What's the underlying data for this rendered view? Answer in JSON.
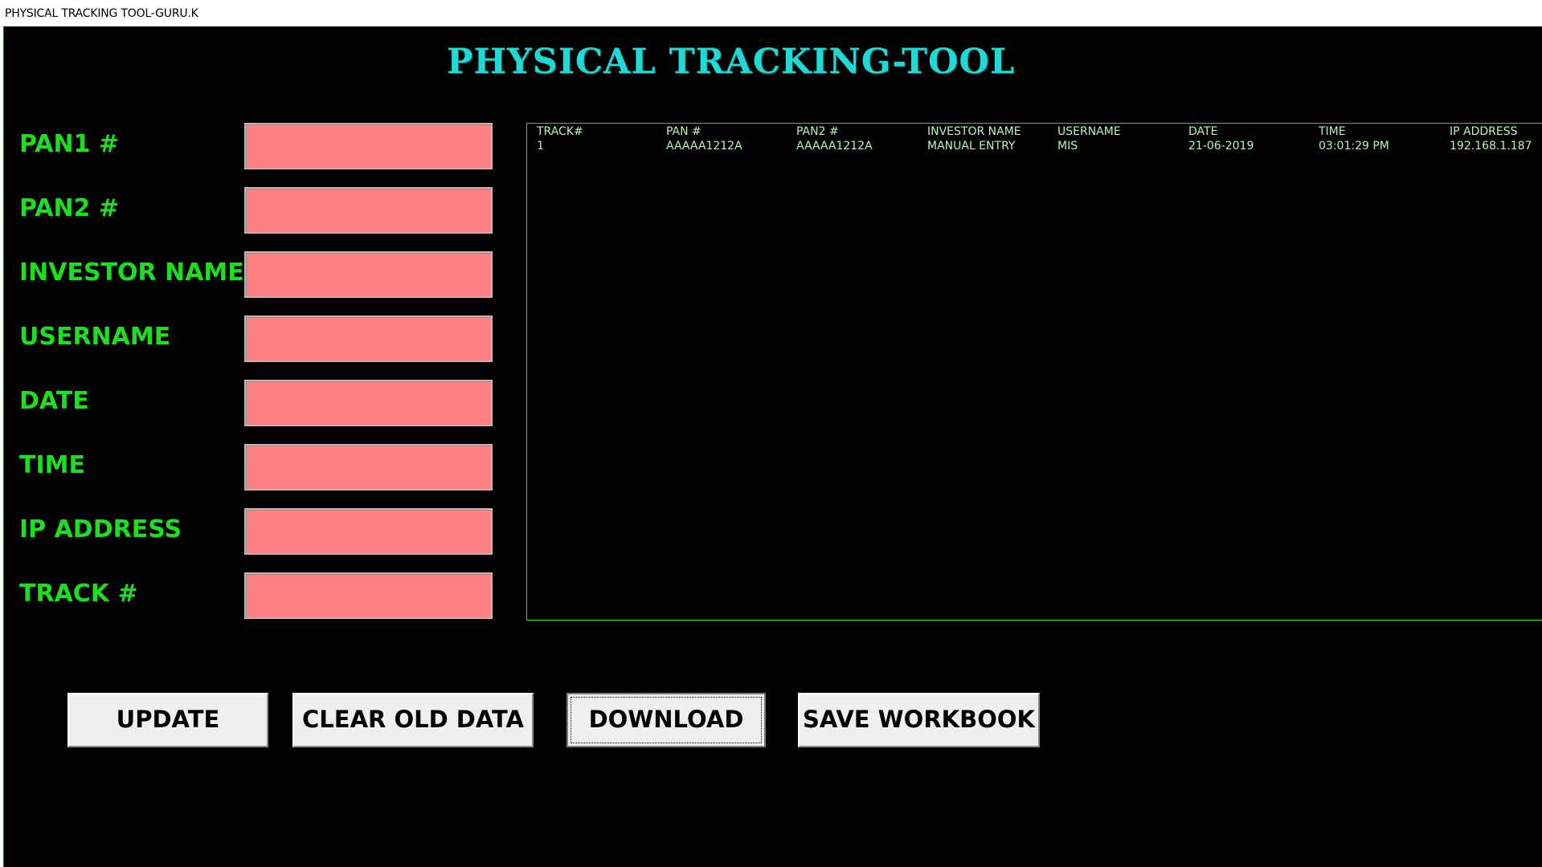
{
  "window": {
    "title": "PHYSICAL TRACKING TOOL-GURU.K"
  },
  "app": {
    "heading": "PHYSICAL TRACKING-TOOL"
  },
  "form": {
    "fields": [
      {
        "label": "PAN1 #",
        "value": ""
      },
      {
        "label": "PAN2 #",
        "value": ""
      },
      {
        "label": "INVESTOR NAME",
        "value": ""
      },
      {
        "label": "USERNAME",
        "value": ""
      },
      {
        "label": "DATE",
        "value": ""
      },
      {
        "label": "TIME",
        "value": ""
      },
      {
        "label": "IP ADDRESS",
        "value": ""
      },
      {
        "label": "TRACK #",
        "value": ""
      }
    ]
  },
  "listbox": {
    "headers": [
      "TRACK#",
      "PAN #",
      "PAN2 #",
      "INVESTOR NAME",
      "USERNAME",
      "DATE",
      "TIME",
      "IP ADDRESS"
    ],
    "rows": [
      [
        "1",
        "AAAAA1212A",
        "AAAAA1212A",
        "MANUAL ENTRY",
        "MIS",
        "21-06-2019",
        "03:01:29 PM",
        "192.168.1.187"
      ]
    ]
  },
  "buttons": {
    "update": "UPDATE",
    "clear": "CLEAR OLD DATA",
    "download": "DOWNLOAD",
    "save": "SAVE WORKBOOK"
  },
  "colors": {
    "background": "#000000",
    "label_green": "#1ddf1d",
    "title_cyan": "#1fd9d4",
    "input_pink": "#ff8080",
    "list_text": "#b8f5b8"
  }
}
